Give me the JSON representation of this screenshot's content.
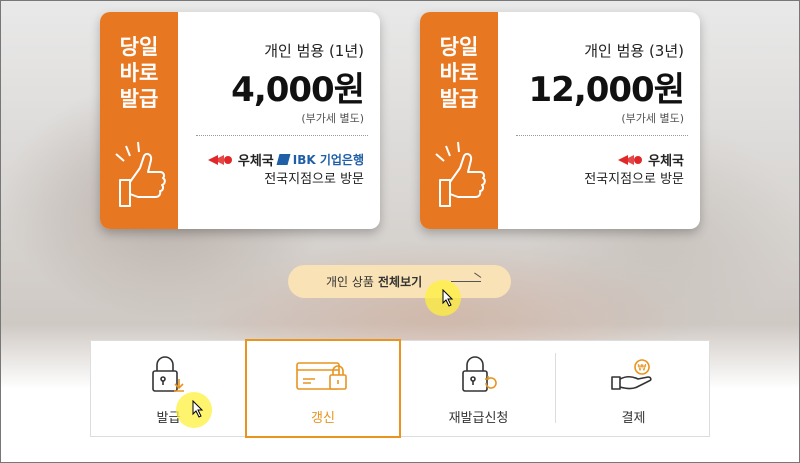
{
  "cards": [
    {
      "badge_lines": [
        "당일",
        "바로",
        "발급"
      ],
      "title": "개인 범용 (1년)",
      "price": "4,000원",
      "vat_note": "(부가세 별도)",
      "logos": [
        "우체국",
        "IBK 기업은행"
      ],
      "branch_note": "전국지점으로 방문"
    },
    {
      "badge_lines": [
        "당일",
        "바로",
        "발급"
      ],
      "title": "개인 범용 (3년)",
      "price": "12,000원",
      "vat_note": "(부가세 별도)",
      "logos": [
        "우체국"
      ],
      "branch_note": "전국지점으로 방문"
    }
  ],
  "view_all": {
    "prefix": "개인 상품",
    "bold": "전체보기"
  },
  "menu": [
    {
      "label": "발급",
      "icon": "lock-download-icon"
    },
    {
      "label": "갱신",
      "icon": "card-lock-icon",
      "active": true
    },
    {
      "label": "재발급신청",
      "icon": "lock-refresh-icon"
    },
    {
      "label": "결제",
      "icon": "hand-coin-icon"
    }
  ],
  "colors": {
    "accent": "#e87722",
    "active_border": "#e8941f",
    "ibk_blue": "#1f5fa8"
  }
}
